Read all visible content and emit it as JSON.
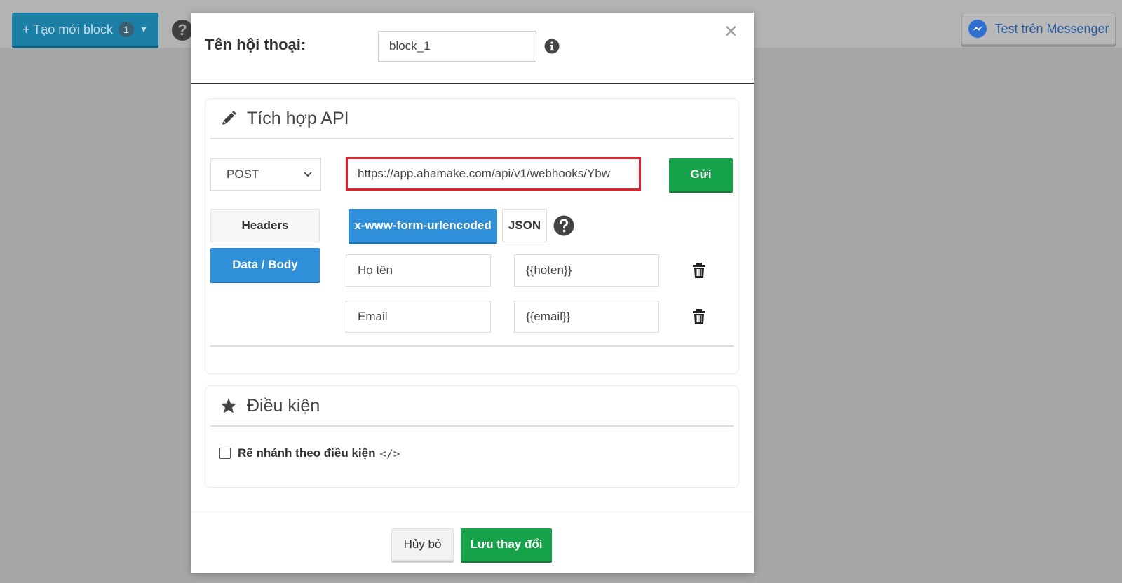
{
  "background": {
    "create_block_label": "+ Tạo mới block",
    "create_block_count": "1",
    "messenger_label": "Test trên Messenger"
  },
  "modal": {
    "title_label": "Tên hội thoại:",
    "name_value": "block_1",
    "api_section": {
      "title": "Tích hợp API",
      "method": "POST",
      "url": "https://app.ahamake.com/api/v1/webhooks/Ybw",
      "send_label": "Gửi",
      "tabs": {
        "headers": "Headers",
        "body": "Data / Body"
      },
      "formats": {
        "urlencoded": "x-www-form-urlencoded",
        "json": "JSON"
      },
      "params": [
        {
          "key": "Họ tên",
          "value": "{{hoten}}"
        },
        {
          "key": "Email",
          "value": "{{email}}"
        }
      ]
    },
    "condition_section": {
      "title": "Điều kiện",
      "branch_label": "Rẽ nhánh theo điều kiện",
      "code_glyph": "</>"
    },
    "footer": {
      "cancel_label": "Hủy bỏ",
      "save_label": "Lưu thay đổi"
    }
  },
  "colors": {
    "primary_blue": "#2f8fd8",
    "success_green": "#16a34a",
    "highlight_red": "#e0202a"
  }
}
